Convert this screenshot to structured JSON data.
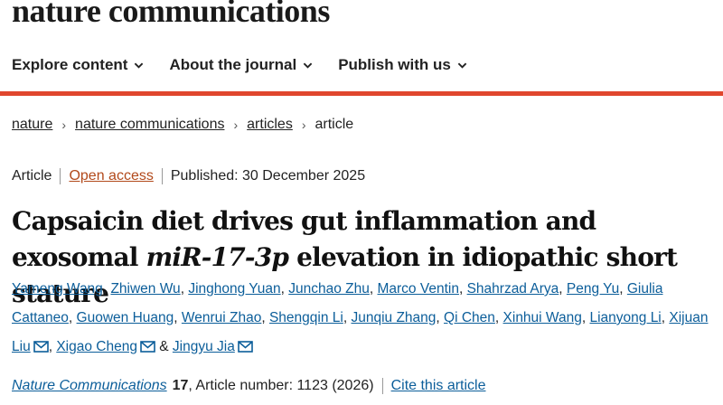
{
  "header": {
    "brand": "nature communications"
  },
  "nav": {
    "items": [
      {
        "label": "Explore content"
      },
      {
        "label": "About the journal"
      },
      {
        "label": "Publish with us"
      }
    ],
    "chevron_icon": "chevron-down-icon"
  },
  "accent_color": "#e0462e",
  "breadcrumb": {
    "items": [
      "nature",
      "nature communications",
      "articles",
      "article"
    ],
    "separator": "›"
  },
  "article": {
    "type": "Article",
    "access": "Open access",
    "published": "Published: 30 December 2025",
    "title_part1": "Capsaicin diet drives gut inflammation and exosomal ",
    "title_italic": "miR-17-3p",
    "title_part2": " elevation in idiopathic short stature"
  },
  "authors": [
    "Yameng Wang",
    "Zhiwen Wu",
    "Jinghong Yuan",
    "Junchao Zhu",
    "Marco Ventin",
    "Shahrzad Arya",
    "Peng Yu",
    "Giulia Cattaneo",
    "Guowen Huang",
    "Wenrui Zhao",
    "Shengqin Li",
    "Junqiu Zhang",
    "Qi Chen",
    "Xinhui Wang",
    "Lianyong Li",
    "Xijuan Liu",
    "Xigao Cheng",
    "Jingyu Jia"
  ],
  "authors_sep": ", ",
  "authors_and": " & ",
  "citation": {
    "journal": "Nature Communications",
    "volume": "17",
    "article_number": ", Article number: 1123 (2026)",
    "cite_label": "Cite this article"
  }
}
